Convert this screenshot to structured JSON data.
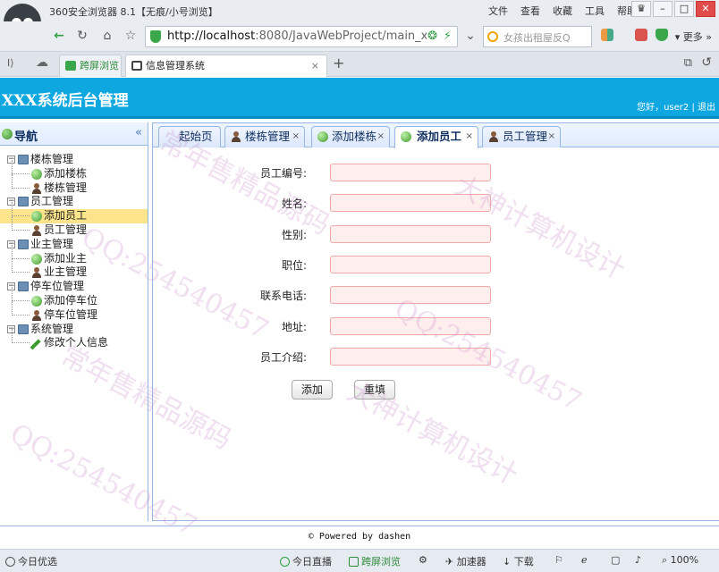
{
  "browser": {
    "title": "360安全浏览器 8.1【无痕/小号浏览】",
    "menu": [
      "文件",
      "查看",
      "收藏",
      "工具",
      "帮助"
    ],
    "url_host": "http://localhost",
    "url_path": ":8080/JavaWebProject/main_x",
    "search_placeholder": "女孩出租屋反Q",
    "more_label": "更多",
    "tabs": [
      {
        "label": "跨屏浏览"
      },
      {
        "label": "信息管理系统"
      }
    ]
  },
  "app": {
    "title": "XXX系统后台管理",
    "user_info": "您好，user2 | 退出"
  },
  "sidebar": {
    "heading": "导航",
    "collapse_glyph": "«",
    "groups": [
      {
        "label": "楼栋管理",
        "items": [
          "添加楼栋",
          "楼栋管理"
        ]
      },
      {
        "label": "员工管理",
        "items": [
          "添加员工",
          "员工管理"
        ]
      },
      {
        "label": "业主管理",
        "items": [
          "添加业主",
          "业主管理"
        ]
      },
      {
        "label": "停车位管理",
        "items": [
          "添加停车位",
          "停车位管理"
        ]
      },
      {
        "label": "系统管理",
        "items": [
          "修改个人信息"
        ]
      }
    ]
  },
  "content_tabs": [
    {
      "label": "起始页",
      "icon": "none"
    },
    {
      "label": "楼栋管理",
      "icon": "user-icon"
    },
    {
      "label": "添加楼栋",
      "icon": "add-icon"
    },
    {
      "label": "添加员工",
      "icon": "add-icon"
    },
    {
      "label": "员工管理",
      "icon": "user-icon"
    }
  ],
  "form": {
    "fields": [
      {
        "label": "员工编号:",
        "value": ""
      },
      {
        "label": "姓名:",
        "value": ""
      },
      {
        "label": "性别:",
        "value": ""
      },
      {
        "label": "职位:",
        "value": ""
      },
      {
        "label": "联系电话:",
        "value": ""
      },
      {
        "label": "地址:",
        "value": ""
      },
      {
        "label": "员工介绍:",
        "value": ""
      }
    ],
    "submit_label": "添加",
    "reset_label": "重填"
  },
  "footer": {
    "text": "© Powered by dashen"
  },
  "statusbar": {
    "left": "今日优选",
    "live": "今日直播",
    "split": "跨屏浏览",
    "accelerate": "加速器",
    "download": "下载",
    "zoom": "100%"
  },
  "watermarks": [
    "常年售精品源码",
    "QQ:254540457",
    "大神计算机设计"
  ],
  "colors": {
    "header_blue": "#0fa7e0",
    "selected_row": "#fbe48a",
    "input_bg": "#ffeeee",
    "input_border": "#f0a9a9"
  }
}
